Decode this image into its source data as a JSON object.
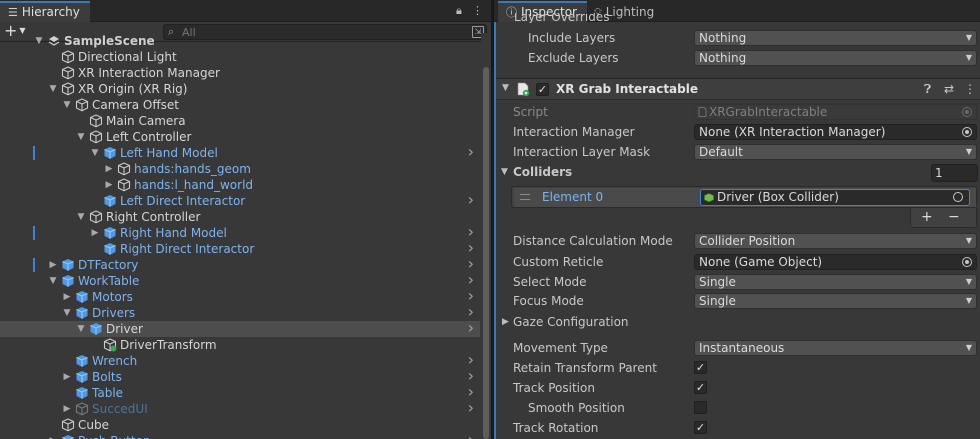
{
  "hierarchy": {
    "tab_label": "Hierarchy",
    "search_placeholder": "All",
    "rows": [
      {
        "label": "SampleScene",
        "style": "bold",
        "indent": 0,
        "fold": "open",
        "icon": "scene",
        "arrow": false,
        "selected": false,
        "mark": false
      },
      {
        "label": "Directional Light",
        "style": "white",
        "indent": 1,
        "fold": "none",
        "icon": "cube-outline",
        "arrow": false,
        "selected": false,
        "mark": false
      },
      {
        "label": "XR Interaction Manager",
        "style": "white",
        "indent": 1,
        "fold": "none",
        "icon": "cube-outline",
        "arrow": false,
        "selected": false,
        "mark": false
      },
      {
        "label": "XR Origin (XR Rig)",
        "style": "white",
        "indent": 1,
        "fold": "open",
        "icon": "cube-outline",
        "arrow": false,
        "selected": false,
        "mark": false
      },
      {
        "label": "Camera Offset",
        "style": "white",
        "indent": 2,
        "fold": "open",
        "icon": "cube-outline",
        "arrow": false,
        "selected": false,
        "mark": false
      },
      {
        "label": "Main Camera",
        "style": "white",
        "indent": 3,
        "fold": "none",
        "icon": "cube-outline",
        "arrow": false,
        "selected": false,
        "mark": false
      },
      {
        "label": "Left Controller",
        "style": "white",
        "indent": 3,
        "fold": "open",
        "icon": "cube-outline",
        "arrow": false,
        "selected": false,
        "mark": false
      },
      {
        "label": "Left Hand Model",
        "style": "blue",
        "indent": 4,
        "fold": "open",
        "icon": "prefab",
        "arrow": true,
        "selected": false,
        "mark": true
      },
      {
        "label": "hands:hands_geom",
        "style": "blue",
        "indent": 5,
        "fold": "closed",
        "icon": "cube-outline",
        "arrow": false,
        "selected": false,
        "mark": false
      },
      {
        "label": "hands:l_hand_world",
        "style": "blue",
        "indent": 5,
        "fold": "closed",
        "icon": "cube-outline",
        "arrow": false,
        "selected": false,
        "mark": false
      },
      {
        "label": "Left Direct Interactor",
        "style": "blue",
        "indent": 4,
        "fold": "none",
        "icon": "prefab",
        "arrow": true,
        "selected": false,
        "mark": false
      },
      {
        "label": "Right Controller",
        "style": "white",
        "indent": 3,
        "fold": "open",
        "icon": "cube-outline",
        "arrow": false,
        "selected": false,
        "mark": false
      },
      {
        "label": "Right Hand Model",
        "style": "blue",
        "indent": 4,
        "fold": "closed",
        "icon": "prefab",
        "arrow": true,
        "selected": false,
        "mark": true
      },
      {
        "label": "Right Direct Interactor",
        "style": "blue",
        "indent": 4,
        "fold": "none",
        "icon": "prefab",
        "arrow": true,
        "selected": false,
        "mark": false
      },
      {
        "label": "DTFactory",
        "style": "blue",
        "indent": 1,
        "fold": "closed",
        "icon": "prefab",
        "arrow": true,
        "selected": false,
        "mark": true
      },
      {
        "label": "WorkTable",
        "style": "blue",
        "indent": 1,
        "fold": "open",
        "icon": "prefab",
        "arrow": true,
        "selected": false,
        "mark": false
      },
      {
        "label": "Motors",
        "style": "blue",
        "indent": 2,
        "fold": "closed",
        "icon": "prefab",
        "arrow": true,
        "selected": false,
        "mark": false
      },
      {
        "label": "Drivers",
        "style": "blue",
        "indent": 2,
        "fold": "open",
        "icon": "prefab",
        "arrow": true,
        "selected": false,
        "mark": false
      },
      {
        "label": "Driver",
        "style": "white",
        "indent": 3,
        "fold": "open",
        "icon": "prefab",
        "arrow": true,
        "selected": true,
        "mark": false
      },
      {
        "label": "DriverTransform",
        "style": "white",
        "indent": 4,
        "fold": "none",
        "icon": "cube-green",
        "arrow": false,
        "selected": false,
        "mark": false
      },
      {
        "label": "Wrench",
        "style": "blue",
        "indent": 2,
        "fold": "none",
        "icon": "prefab",
        "arrow": true,
        "selected": false,
        "mark": false
      },
      {
        "label": "Bolts",
        "style": "blue",
        "indent": 2,
        "fold": "closed",
        "icon": "prefab",
        "arrow": true,
        "selected": false,
        "mark": false
      },
      {
        "label": "Table",
        "style": "blue",
        "indent": 2,
        "fold": "none",
        "icon": "prefab",
        "arrow": true,
        "selected": false,
        "mark": false
      },
      {
        "label": "SuccedUI",
        "style": "dim",
        "indent": 2,
        "fold": "closed",
        "icon": "cube-dim",
        "arrow": true,
        "selected": false,
        "mark": false
      },
      {
        "label": "Cube",
        "style": "white",
        "indent": 1,
        "fold": "none",
        "icon": "cube-outline",
        "arrow": false,
        "selected": false,
        "mark": false
      },
      {
        "label": "Push Button",
        "style": "blue",
        "indent": 1,
        "fold": "closed",
        "icon": "prefab",
        "arrow": true,
        "selected": false,
        "mark": false
      }
    ]
  },
  "inspector": {
    "tab_inspector": "Inspector",
    "tab_lighting": "Lighting",
    "cut_label": "Layer Overrides",
    "include_layers": {
      "label": "Include Layers",
      "value": "Nothing"
    },
    "exclude_layers": {
      "label": "Exclude Layers",
      "value": "Nothing"
    },
    "component_title": "XR Grab Interactable",
    "script": {
      "label": "Script",
      "value": "XRGrabInteractable"
    },
    "interaction_manager": {
      "label": "Interaction Manager",
      "value": "None (XR Interaction Manager)"
    },
    "interaction_layer_mask": {
      "label": "Interaction Layer Mask",
      "value": "Default"
    },
    "colliders": {
      "label": "Colliders",
      "size": "1",
      "element_name": "Element 0",
      "element_value": "Driver (Box Collider)",
      "add": "+",
      "remove": "−"
    },
    "distance_calc": {
      "label": "Distance Calculation Mode",
      "value": "Collider Position"
    },
    "custom_reticle": {
      "label": "Custom Reticle",
      "value": "None (Game Object)"
    },
    "select_mode": {
      "label": "Select Mode",
      "value": "Single"
    },
    "focus_mode": {
      "label": "Focus Mode",
      "value": "Single"
    },
    "gaze_config": {
      "label": "Gaze Configuration"
    },
    "movement_type": {
      "label": "Movement Type",
      "value": "Instantaneous"
    },
    "retain_parent": {
      "label": "Retain Transform Parent",
      "checked": true
    },
    "track_position": {
      "label": "Track Position",
      "checked": true
    },
    "smooth_position": {
      "label": "Smooth Position",
      "checked": false
    },
    "track_rotation": {
      "label": "Track Rotation",
      "checked": true
    }
  },
  "colors": {
    "accent": "#3a79bb",
    "prefab_blue": "#7fb3ef",
    "panel": "#383838"
  }
}
